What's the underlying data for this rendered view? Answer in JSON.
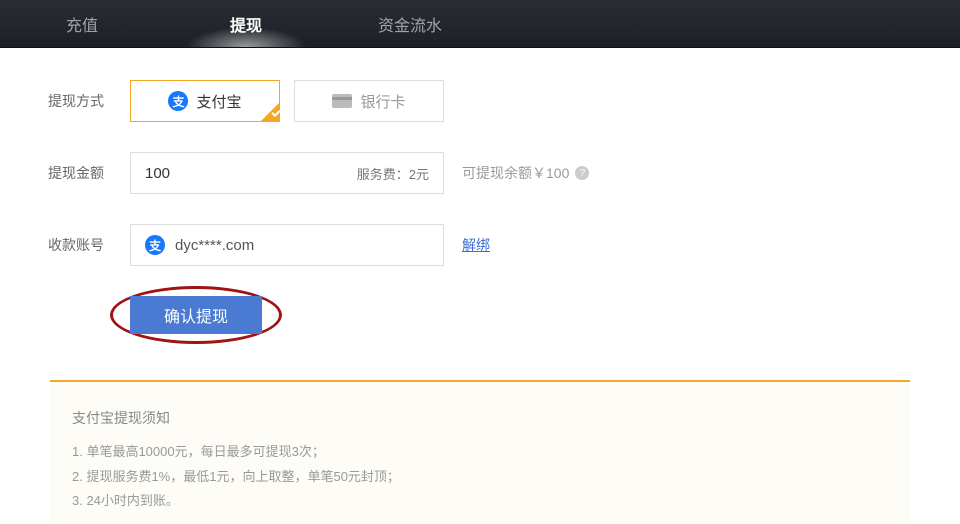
{
  "tabs": {
    "recharge": "充值",
    "withdraw": "提现",
    "flow": "资金流水"
  },
  "labels": {
    "method": "提现方式",
    "amount": "提现金额",
    "account": "收款账号"
  },
  "methods": {
    "alipay": "支付宝",
    "bankcard": "银行卡"
  },
  "amount": {
    "value": "100",
    "fee_label": "服务费：2元"
  },
  "balance": {
    "text": "可提现余额￥100"
  },
  "account": {
    "value": "dyc****.com",
    "unbind": "解绑"
  },
  "confirm": "确认提现",
  "notice": {
    "title": "支付宝提现须知",
    "line1": "1. 单笔最高10000元，每日最多可提现3次；",
    "line2": "2. 提现服务费1%，最低1元，向上取整，单笔50元封顶；",
    "line3": "3. 24小时内到账。"
  },
  "icons": {
    "alipay_glyph": "支",
    "help_glyph": "?"
  }
}
